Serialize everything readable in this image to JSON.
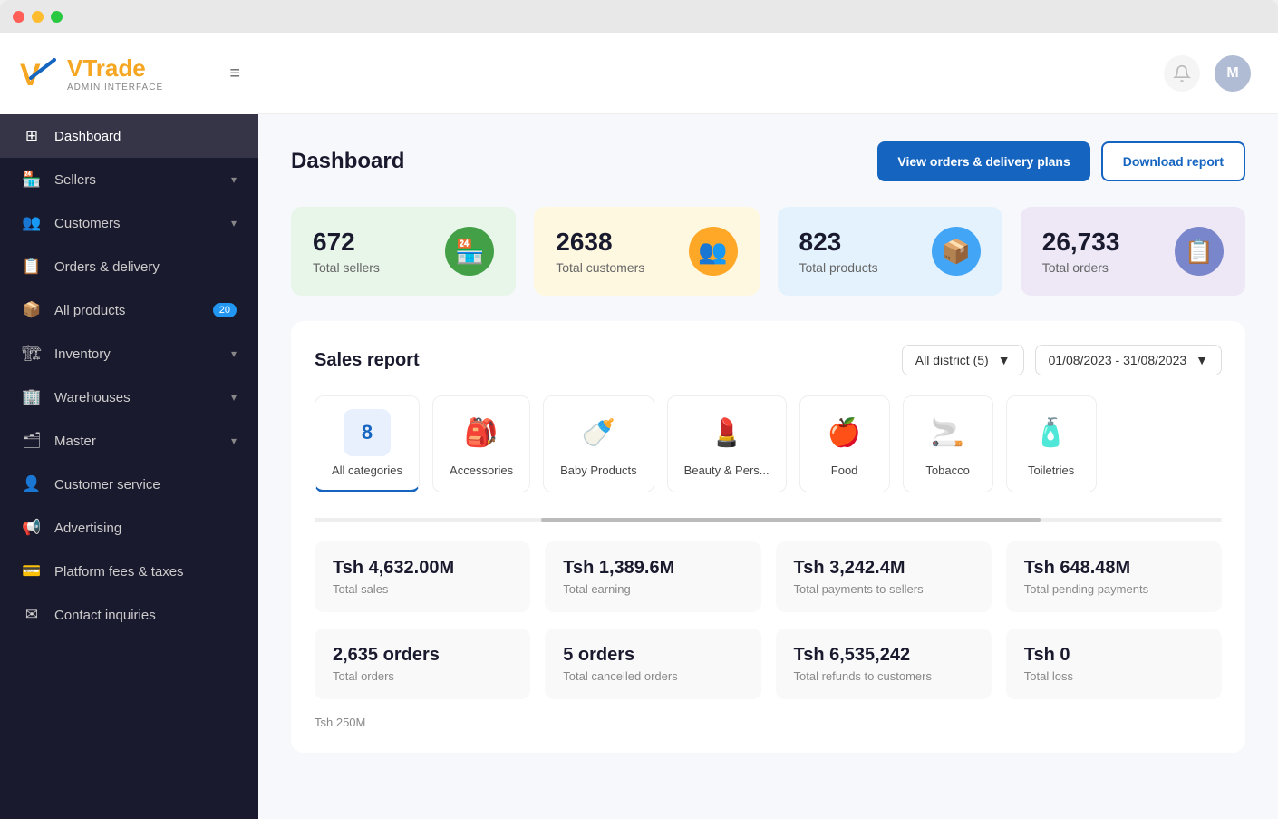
{
  "window": {
    "buttons": [
      "close",
      "min",
      "max"
    ]
  },
  "topbar": {
    "avatar_label": "M"
  },
  "sidebar": {
    "logo_brand": "Trade",
    "logo_sub": "ADMIN INTERFACE",
    "menu_icon": "≡",
    "nav_items": [
      {
        "id": "dashboard",
        "icon": "⊞",
        "label": "Dashboard",
        "active": true,
        "badge": null,
        "chevron": false
      },
      {
        "id": "sellers",
        "icon": "🏪",
        "label": "Sellers",
        "active": false,
        "badge": null,
        "chevron": true
      },
      {
        "id": "customers",
        "icon": "👥",
        "label": "Customers",
        "active": false,
        "badge": null,
        "chevron": true
      },
      {
        "id": "orders",
        "icon": "📋",
        "label": "Orders & delivery",
        "active": false,
        "badge": null,
        "chevron": false
      },
      {
        "id": "allproducts",
        "icon": "📦",
        "label": "All products",
        "active": false,
        "badge": "20",
        "chevron": false
      },
      {
        "id": "inventory",
        "icon": "🏗",
        "label": "Inventory",
        "active": false,
        "badge": null,
        "chevron": true
      },
      {
        "id": "warehouses",
        "icon": "🏢",
        "label": "Warehouses",
        "active": false,
        "badge": null,
        "chevron": true
      },
      {
        "id": "master",
        "icon": "🗂",
        "label": "Master",
        "active": false,
        "badge": null,
        "chevron": true
      },
      {
        "id": "customerservice",
        "icon": "👤",
        "label": "Customer service",
        "active": false,
        "badge": null,
        "chevron": false
      },
      {
        "id": "advertising",
        "icon": "📢",
        "label": "Advertising",
        "active": false,
        "badge": null,
        "chevron": false
      },
      {
        "id": "fees",
        "icon": "💳",
        "label": "Platform fees & taxes",
        "active": false,
        "badge": null,
        "chevron": false
      },
      {
        "id": "inquiries",
        "icon": "✉",
        "label": "Contact inquiries",
        "active": false,
        "badge": null,
        "chevron": false
      }
    ]
  },
  "page": {
    "title": "Dashboard",
    "btn_view": "View orders & delivery plans",
    "btn_download": "Download report"
  },
  "stats": [
    {
      "id": "sellers",
      "number": "672",
      "label": "Total sellers",
      "color": "green",
      "icon": "🏪"
    },
    {
      "id": "customers",
      "number": "2638",
      "label": "Total customers",
      "color": "orange",
      "icon": "👥"
    },
    {
      "id": "products",
      "number": "823",
      "label": "Total products",
      "color": "blue",
      "icon": "📦"
    },
    {
      "id": "orders",
      "number": "26,733",
      "label": "Total orders",
      "color": "purple",
      "icon": "📋"
    }
  ],
  "sales_report": {
    "title": "Sales report",
    "filter_district": "All district (5)",
    "filter_date": "01/08/2023 - 31/08/2023",
    "categories": [
      {
        "id": "all",
        "label": "All categories",
        "count": "8",
        "active": true,
        "emoji": ""
      },
      {
        "id": "accessories",
        "label": "Accessories",
        "count": null,
        "active": false,
        "emoji": "🎒"
      },
      {
        "id": "baby",
        "label": "Baby Products",
        "count": null,
        "active": false,
        "emoji": "🍼"
      },
      {
        "id": "beauty",
        "label": "Beauty & Pers...",
        "count": null,
        "active": false,
        "emoji": "💄"
      },
      {
        "id": "food",
        "label": "Food",
        "count": null,
        "active": false,
        "emoji": "🍎"
      },
      {
        "id": "tobacco",
        "label": "Tobacco",
        "count": null,
        "active": false,
        "emoji": "🚬"
      },
      {
        "id": "toiletries",
        "label": "Toiletries",
        "count": null,
        "active": false,
        "emoji": "🧴"
      }
    ],
    "metrics": [
      {
        "id": "total_sales",
        "value": "Tsh 4,632.00M",
        "label": "Total sales"
      },
      {
        "id": "total_earning",
        "value": "Tsh 1,389.6M",
        "label": "Total earning"
      },
      {
        "id": "payments_sellers",
        "value": "Tsh 3,242.4M",
        "label": "Total payments to sellers"
      },
      {
        "id": "pending_payments",
        "value": "Tsh 648.48M",
        "label": "Total pending payments"
      }
    ],
    "metrics2": [
      {
        "id": "total_orders",
        "value": "2,635 orders",
        "label": "Total orders"
      },
      {
        "id": "cancelled_orders",
        "value": "5 orders",
        "label": "Total cancelled orders"
      },
      {
        "id": "refunds",
        "value": "Tsh 6,535,242",
        "label": "Total refunds to customers"
      },
      {
        "id": "total_loss",
        "value": "Tsh 0",
        "label": "Total loss"
      }
    ],
    "chart_label": "Tsh 250M"
  }
}
